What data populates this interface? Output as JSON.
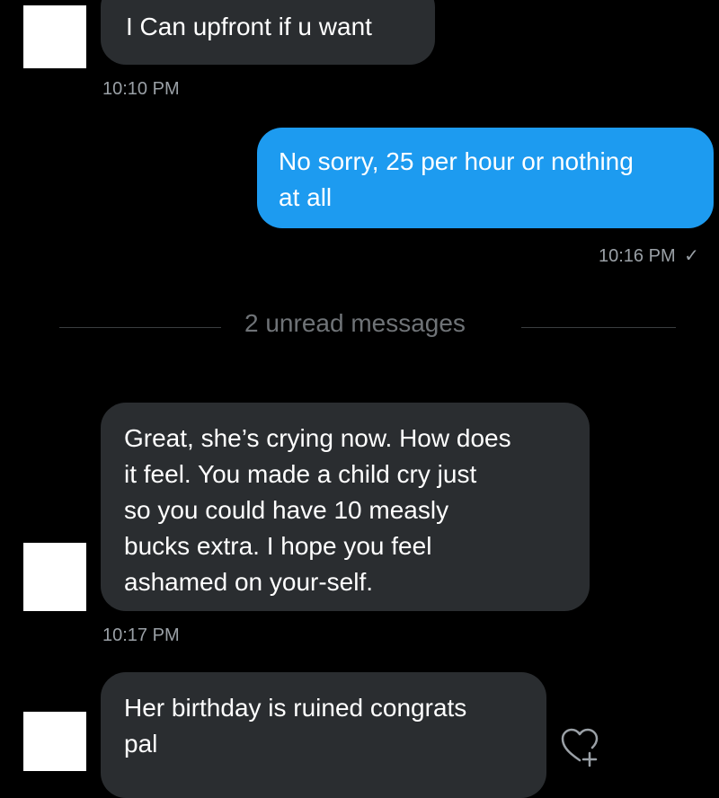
{
  "messages": {
    "m1": {
      "text": "I Can  upfront if u want",
      "time": "10:10 PM"
    },
    "m2": {
      "text_line1": "No sorry, 25 per hour or nothing",
      "text_line2": "at all",
      "time": "10:16 PM",
      "read_mark": "✓"
    },
    "m3": {
      "lines": [
        "Great, she’s crying now. How does",
        "it feel. You made a child cry just",
        "so you could have 10 measly",
        "bucks extra. I hope you feel",
        "ashamed on your-self."
      ],
      "time": "10:17 PM"
    },
    "m4": {
      "lines": [
        "Her birthday is ruined congrats",
        "pal"
      ]
    }
  },
  "divider": {
    "label": "2 unread messages"
  },
  "icons": {
    "react": "heart-plus-icon"
  },
  "colors": {
    "background": "#000000",
    "incoming_bubble": "#2a2d30",
    "outgoing_bubble": "#1d9bf0",
    "timestamp": "#9aa0a6",
    "divider_text": "#6f7377"
  }
}
